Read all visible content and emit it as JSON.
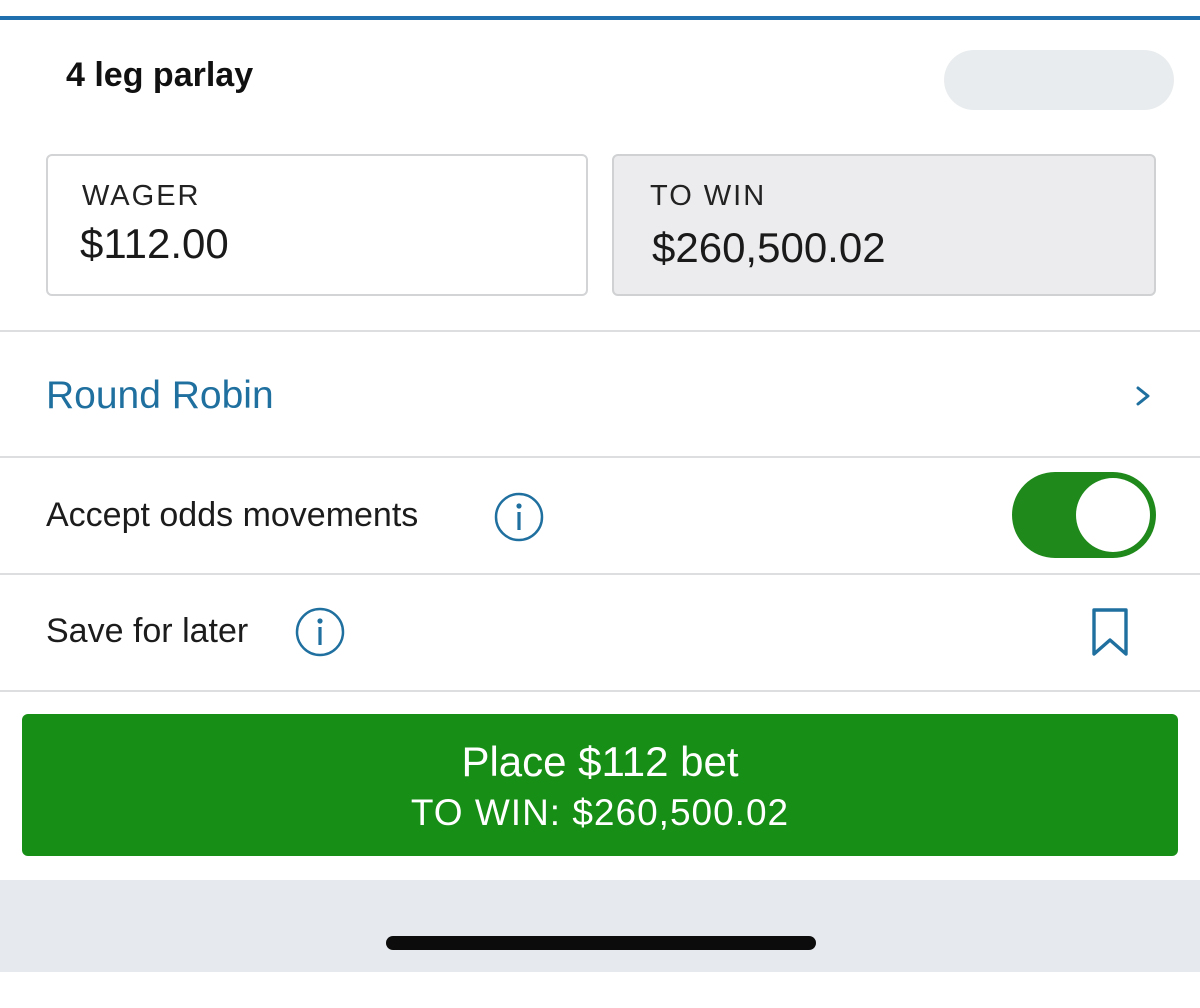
{
  "header": {
    "title": "4 leg parlay"
  },
  "wager": {
    "label": "WAGER",
    "value": "$112.00"
  },
  "to_win": {
    "label": "TO WIN",
    "value": "$260,500.02"
  },
  "round_robin": {
    "label": "Round Robin",
    "icon": "chevron-right-icon"
  },
  "accept_odds": {
    "label": "Accept odds movements",
    "toggle_on": true,
    "toggle_color": "#1f8a1b"
  },
  "save_later": {
    "label": "Save for later",
    "icon": "bookmark-icon"
  },
  "place_button": {
    "main_label": "Place $112 bet",
    "sub_label": "TO WIN: $260,500.02",
    "color": "#178f16"
  },
  "colors": {
    "accent_blue": "#1f6f9f",
    "divider": "#dcdee0"
  }
}
